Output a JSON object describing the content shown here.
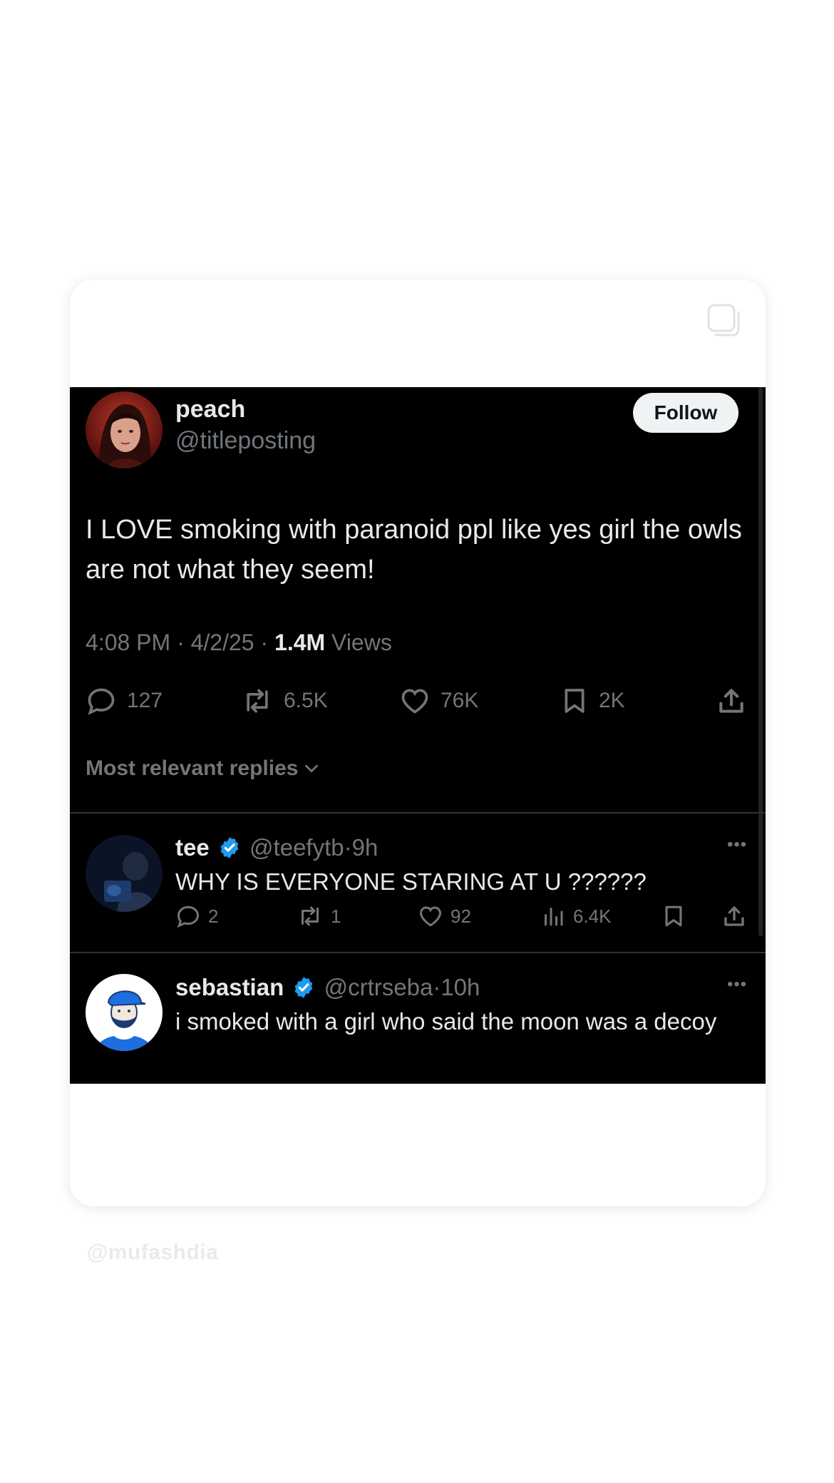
{
  "post": {
    "author_name": "peach",
    "author_handle": "@titleposting",
    "follow_label": "Follow",
    "text": "I LOVE smoking with paranoid ppl like yes girl the owls are not what they seem!",
    "time": "4:08 PM",
    "date": "4/2/25",
    "views_count": "1.4M",
    "views_label": "Views",
    "separator": "·",
    "replies": "127",
    "reposts": "6.5K",
    "likes": "76K",
    "bookmarks": "2K"
  },
  "replies_filter": "Most relevant replies",
  "replies": [
    {
      "name": "tee",
      "handle": "@teefytb",
      "time": "9h",
      "text": "WHY IS EVERYONE STARING AT U ??????",
      "replies": "2",
      "reposts": "1",
      "likes": "92",
      "views": "6.4K"
    },
    {
      "name": "sebastian",
      "handle": "@crtrseba",
      "time": "10h",
      "text": "i smoked with a girl who said the moon was a decoy"
    }
  ],
  "more_label": "•••",
  "watermark": "@mufashdia",
  "colors": {
    "background": "#000000",
    "text": "#e7e9ea",
    "muted": "#71767b",
    "verified": "#1d9bf0",
    "follow_bg": "#eff3f4"
  }
}
